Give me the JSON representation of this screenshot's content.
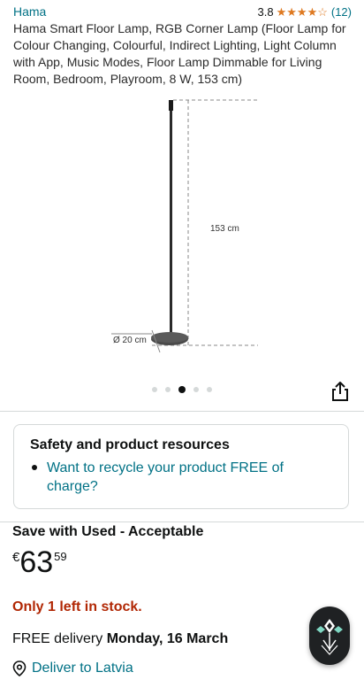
{
  "product": {
    "brand": "Hama",
    "rating": "3.8",
    "stars_filled": 4,
    "stars_total": 5,
    "review_count": "(12)",
    "title": "Hama Smart Floor Lamp, RGB Corner Lamp (Floor Lamp for Colour Changing, Colourful, Indirect Lighting, Light Column with App, Music Modes, Floor Lamp Dimmable for Living Room, Bedroom, Playroom, 8 W, 153 cm)"
  },
  "gallery": {
    "height_label": "153 cm",
    "base_label": "Ø 20 cm",
    "image_count": 5,
    "active_index": 2
  },
  "safety": {
    "title": "Safety and product resources",
    "link": "Want to recycle your product FREE of charge?"
  },
  "offer": {
    "used_label": "Save with Used - Acceptable",
    "currency": "€",
    "price_whole": "63",
    "price_fraction": "59",
    "stock": "Only 1 left in stock.",
    "delivery_prefix": "FREE delivery ",
    "delivery_date": "Monday, 16 March",
    "deliver_to": "Deliver to Latvia"
  },
  "icons": {
    "share": "share-icon",
    "location": "location-pin-icon",
    "assistant": "assistant-icon"
  },
  "colors": {
    "link": "#007185",
    "star": "#de7921",
    "stock": "#b12704"
  }
}
